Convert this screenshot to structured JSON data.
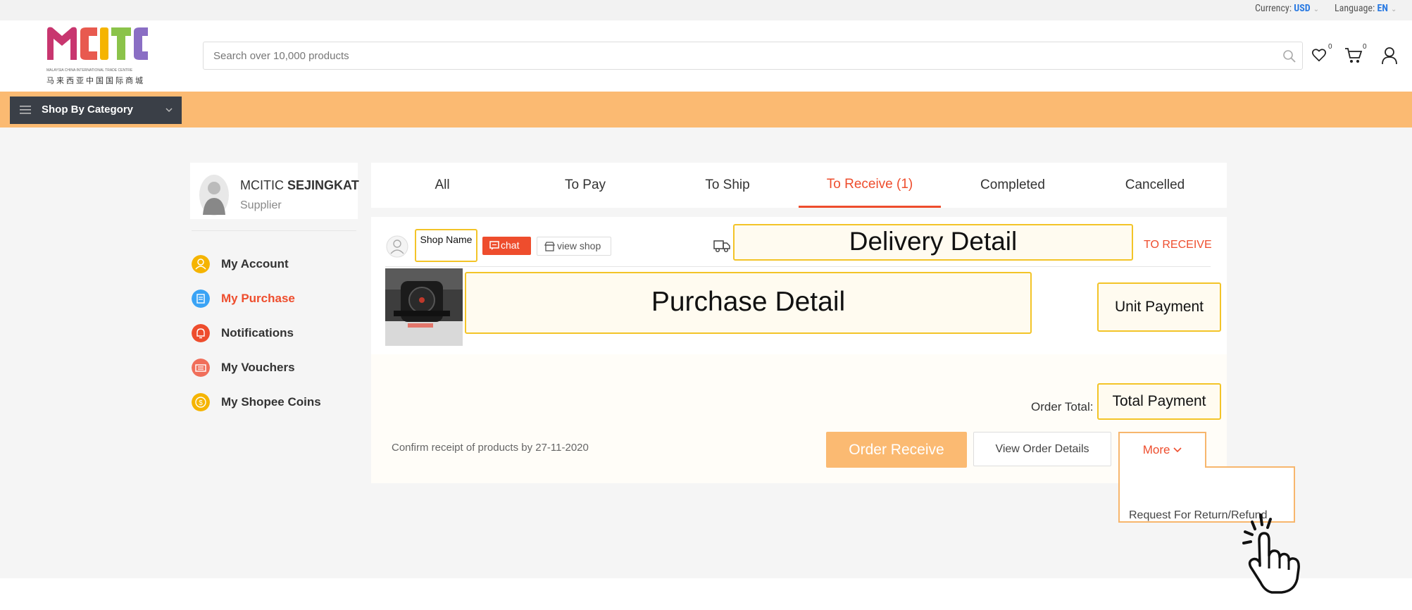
{
  "topbar": {
    "currency_label": "Currency:",
    "currency_value": "USD",
    "language_label": "Language:",
    "language_value": "EN"
  },
  "header": {
    "logo_text": "MCITC",
    "logo_sub_en": "MALAYSIA CHINA INTERNATIONAL TRADE CENTRE",
    "logo_sub_cn": "马来西亚中国国际商城",
    "search_placeholder": "Search over 10,000 products",
    "wishlist_count": "0",
    "cart_count": "0"
  },
  "category": {
    "label": "Shop By Category"
  },
  "profile": {
    "name_first": "MCITIC",
    "name_second": "SEJINGKAT",
    "role": "Supplier"
  },
  "sidebar": {
    "items": [
      {
        "label": "My Account",
        "color": "#f5b400"
      },
      {
        "label": "My Purchase",
        "color": "#3aa3f5"
      },
      {
        "label": "Notifications",
        "color": "#ee4d2d"
      },
      {
        "label": "My Vouchers",
        "color": "#f06e5a"
      },
      {
        "label": "My Shopee Coins",
        "color": "#f5b400"
      }
    ]
  },
  "tabs": [
    "All",
    "To Pay",
    "To Ship",
    "To Receive (1)",
    "Completed",
    "Cancelled"
  ],
  "order": {
    "shop_name": "Shop Name",
    "chat_label": "chat",
    "view_shop_label": "view shop",
    "delivery_detail": "Delivery Detail",
    "status": "TO RECEIVE",
    "purchase_detail": "Purchase Detail",
    "unit_payment": "Unit Payment",
    "order_total_label": "Order Total:",
    "total_payment": "Total Payment",
    "confirm_text": "Confirm receipt of products by 27-11-2020",
    "receive_button": "Order Receive",
    "details_button": "View Order Details",
    "more_button": "More",
    "dropdown_item": "Request For Return/Refund"
  },
  "colors": {
    "accent": "#ee4d2d",
    "orange_bar": "#fbba72",
    "highlight_border": "#f3c428"
  }
}
